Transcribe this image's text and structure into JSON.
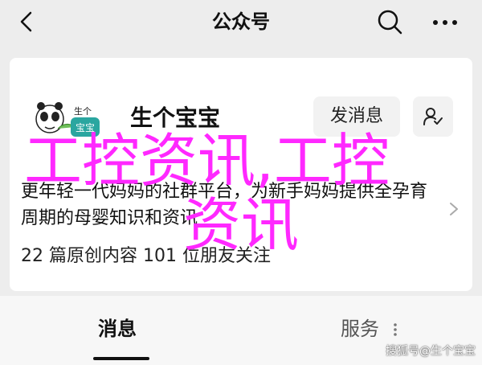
{
  "topbar": {
    "title": "公众号",
    "icons": {
      "back": "back-arrow-icon",
      "search": "search-icon",
      "more": "more-icon"
    }
  },
  "profile": {
    "logo_text_top": "生个",
    "logo_text_bottom": "宝宝",
    "name": "生个宝宝",
    "send_message_label": "发消息",
    "follow_icon": "user-check-icon"
  },
  "description": "更年轻一代妈妈的社群平台，为新手妈妈提供全孕育周期的母婴知识和资讯",
  "stats": "22 篇原创内容  101 位朋友关注",
  "overlay": {
    "line1": "工控资讯,工控",
    "line2": "资讯"
  },
  "tabs": [
    {
      "label": "消息",
      "active": true
    },
    {
      "label": "服务",
      "active": false
    }
  ],
  "watermark": "搜狐号@生个宝宝",
  "colors": {
    "overlay": "#ff28ff",
    "background": "#ededed",
    "card": "#ffffff"
  }
}
